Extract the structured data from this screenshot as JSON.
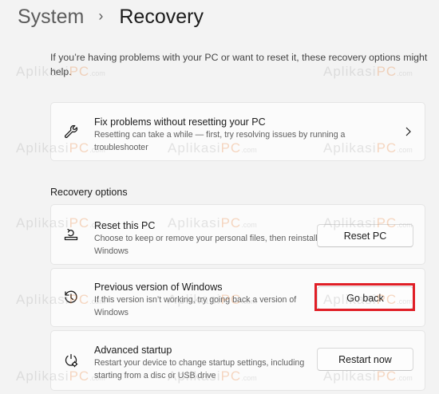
{
  "breadcrumb": {
    "parent": "System",
    "separator": "›",
    "current": "Recovery"
  },
  "intro": "If you’re having problems with your PC or want to reset it, these recovery options might help.",
  "fix_card": {
    "title": "Fix problems without resetting your PC",
    "description": "Resetting can take a while — first, try resolving issues by running a troubleshooter",
    "icon": "wrench-icon"
  },
  "section_title": "Recovery options",
  "options": [
    {
      "title": "Reset this PC",
      "description": "Choose to keep or remove your personal files, then reinstall Windows",
      "button": "Reset PC",
      "icon": "reset-pc-icon"
    },
    {
      "title": "Previous version of Windows",
      "description": "If this version isn’t working, try going back a version of Windows",
      "button": "Go back",
      "icon": "history-icon"
    },
    {
      "title": "Advanced startup",
      "description": "Restart your device to change startup settings, including starting from a disc or USB drive",
      "button": "Restart now",
      "icon": "advanced-startup-icon"
    }
  ],
  "watermark": {
    "prefix": "Aplikasi",
    "highlight": "PC",
    "suffix": ".com"
  },
  "colors": {
    "background": "#f3f3f3",
    "card": "#fbfbfb",
    "highlight_box": "#e01e26"
  }
}
